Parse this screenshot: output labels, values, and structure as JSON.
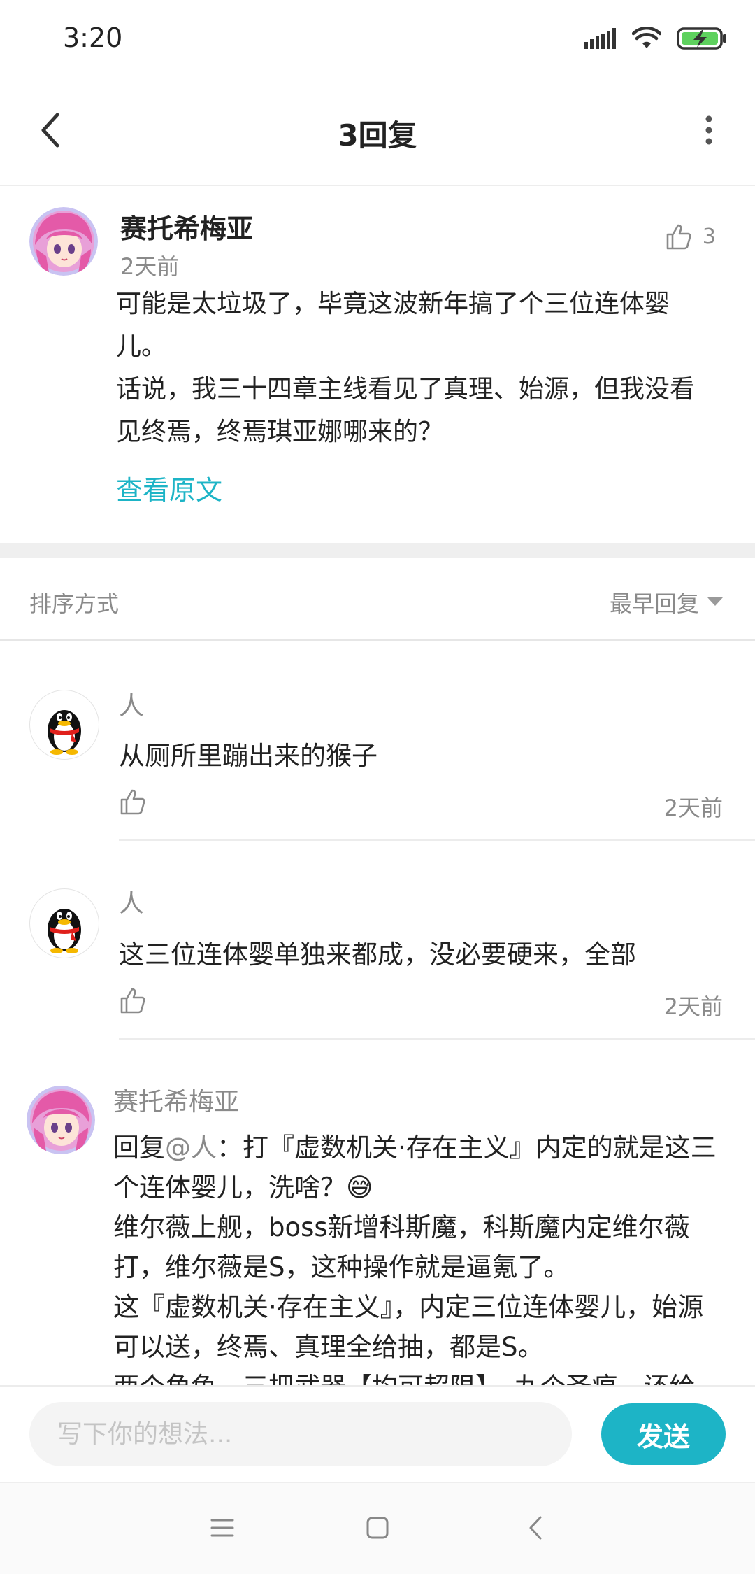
{
  "status_bar": {
    "time": "3:20",
    "icons": [
      "signal-icon",
      "wifi-icon",
      "battery-charging-icon"
    ]
  },
  "header": {
    "title": "3回复",
    "back_icon": "chevron-left-icon",
    "more_icon": "more-vertical-icon"
  },
  "original_post": {
    "author": "赛托希梅亚",
    "time": "2天前",
    "like_count": "3",
    "body_lines": [
      "可能是太垃圾了，毕竟这波新年搞了个三位连体婴",
      "儿。",
      "话说，我三十四章主线看见了真理、始源，但我没看",
      "见终焉，终焉琪亚娜哪来的？"
    ],
    "view_original": "查看原文"
  },
  "sort": {
    "label": "排序方式",
    "value": "最早回复"
  },
  "replies": [
    {
      "author": "人",
      "text": "从厕所里蹦出来的猴子",
      "time": "2天前"
    },
    {
      "author": "人",
      "text": "这三位连体婴单独来都成，没必要硬来，全部",
      "time": "2天前"
    },
    {
      "author": "赛托希梅亚",
      "reply_prefix": "回复",
      "mention": "@人",
      "first_line_rest": "：打『虚数机关·存在主义』内定的就是这三",
      "lines": [
        "个连体婴儿，洗啥？😅",
        "维尔薇上舰，boss新增科斯魔，科斯魔内定维尔薇",
        "打，维尔薇是S，这种操作就是逼氪了。",
        "这『虚数机关·存在主义』，内定三位连体婴儿，始源",
        "可以送，终焉、真理全给抽，都是S。",
        "两个角色，三把武器【均可超限】，九个圣痕，还给"
      ]
    }
  ],
  "composer": {
    "placeholder": "写下你的想法...",
    "send_label": "发送"
  },
  "colors": {
    "accent": "#1db4c6",
    "muted_text": "#8a8a8a"
  }
}
